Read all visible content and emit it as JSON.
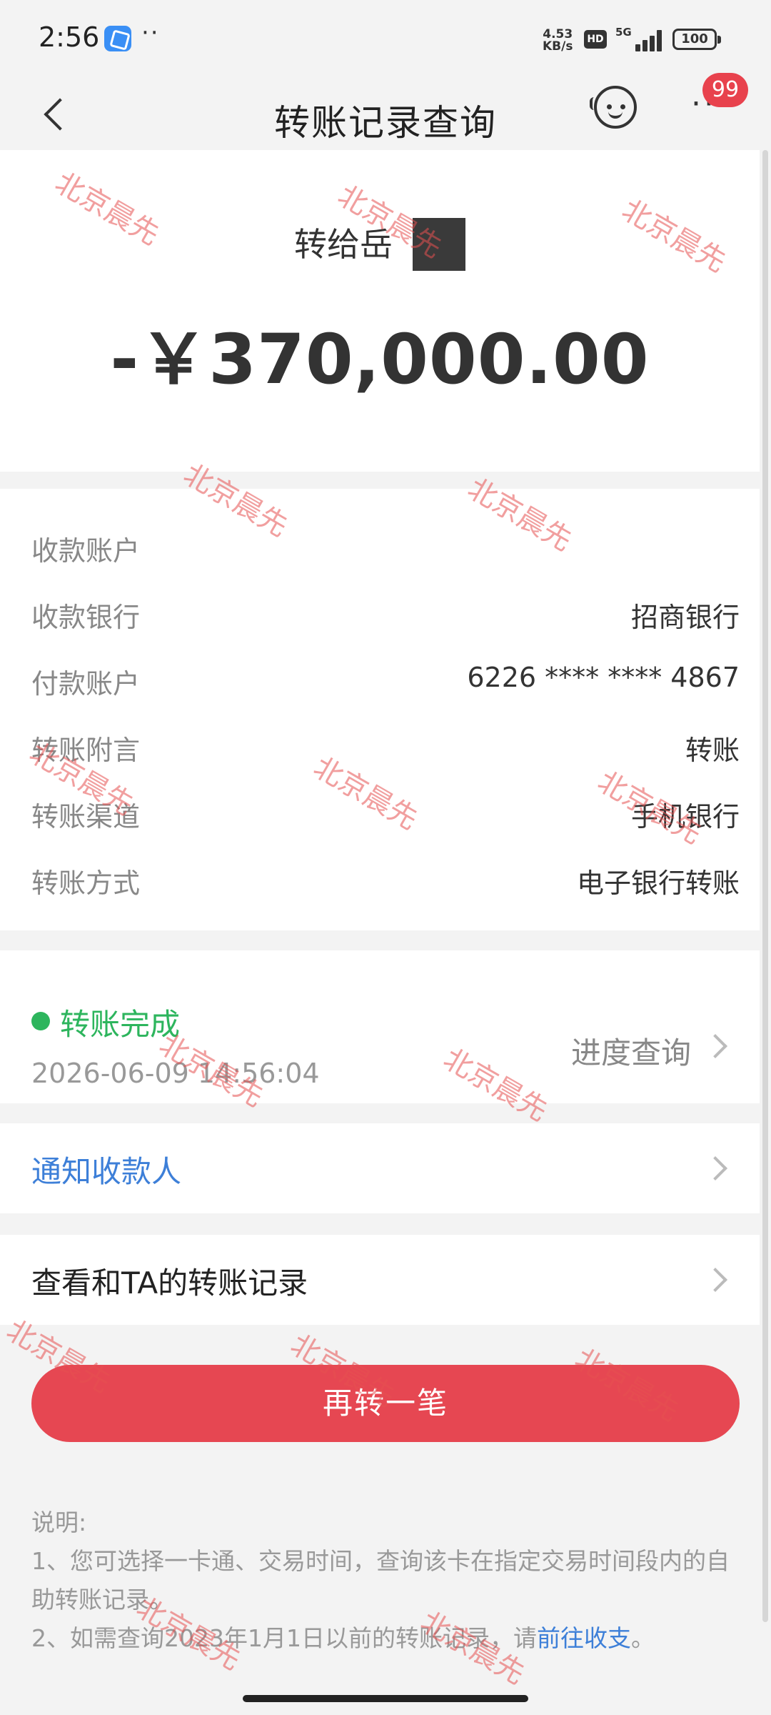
{
  "status_bar": {
    "time": "2:56",
    "dots": "··",
    "net_speed": "4.53",
    "net_unit": "KB/s",
    "hd": "HD",
    "network": "5G",
    "battery": "100"
  },
  "nav": {
    "title": "转账记录查询",
    "badge": "99",
    "more": "···"
  },
  "transfer": {
    "payee_label": "转给岳",
    "amount": "-￥370,000.00"
  },
  "details": [
    {
      "label": "收款账户",
      "value": ""
    },
    {
      "label": "收款银行",
      "value": "招商银行"
    },
    {
      "label": "付款账户",
      "value": "6226 **** **** 4867"
    },
    {
      "label": "转账附言",
      "value": "转账"
    },
    {
      "label": "转账渠道",
      "value": "手机银行"
    },
    {
      "label": "转账方式",
      "value": "电子银行转账"
    }
  ],
  "status": {
    "text": "转账完成",
    "time": "2026-06-09 14:56:04",
    "progress_label": "进度查询"
  },
  "actions": {
    "notify": "通知收款人",
    "history": "查看和TA的转账记录",
    "again": "再转一笔"
  },
  "notes": {
    "title": "说明:",
    "line1": "1、您可选择一卡通、交易时间，查询该卡在指定交易时间段内的自助转账记录。",
    "line2_prefix": "2、如需查询2023年1月1日以前的转账记录，请",
    "line2_link": "前往收支",
    "line2_suffix": "。"
  },
  "watermark": "北京晨先",
  "colors": {
    "success": "#2db55d",
    "link": "#3d7fd8",
    "primary_button": "#e64752",
    "badge": "#e8424d",
    "watermark": "#e65050"
  }
}
